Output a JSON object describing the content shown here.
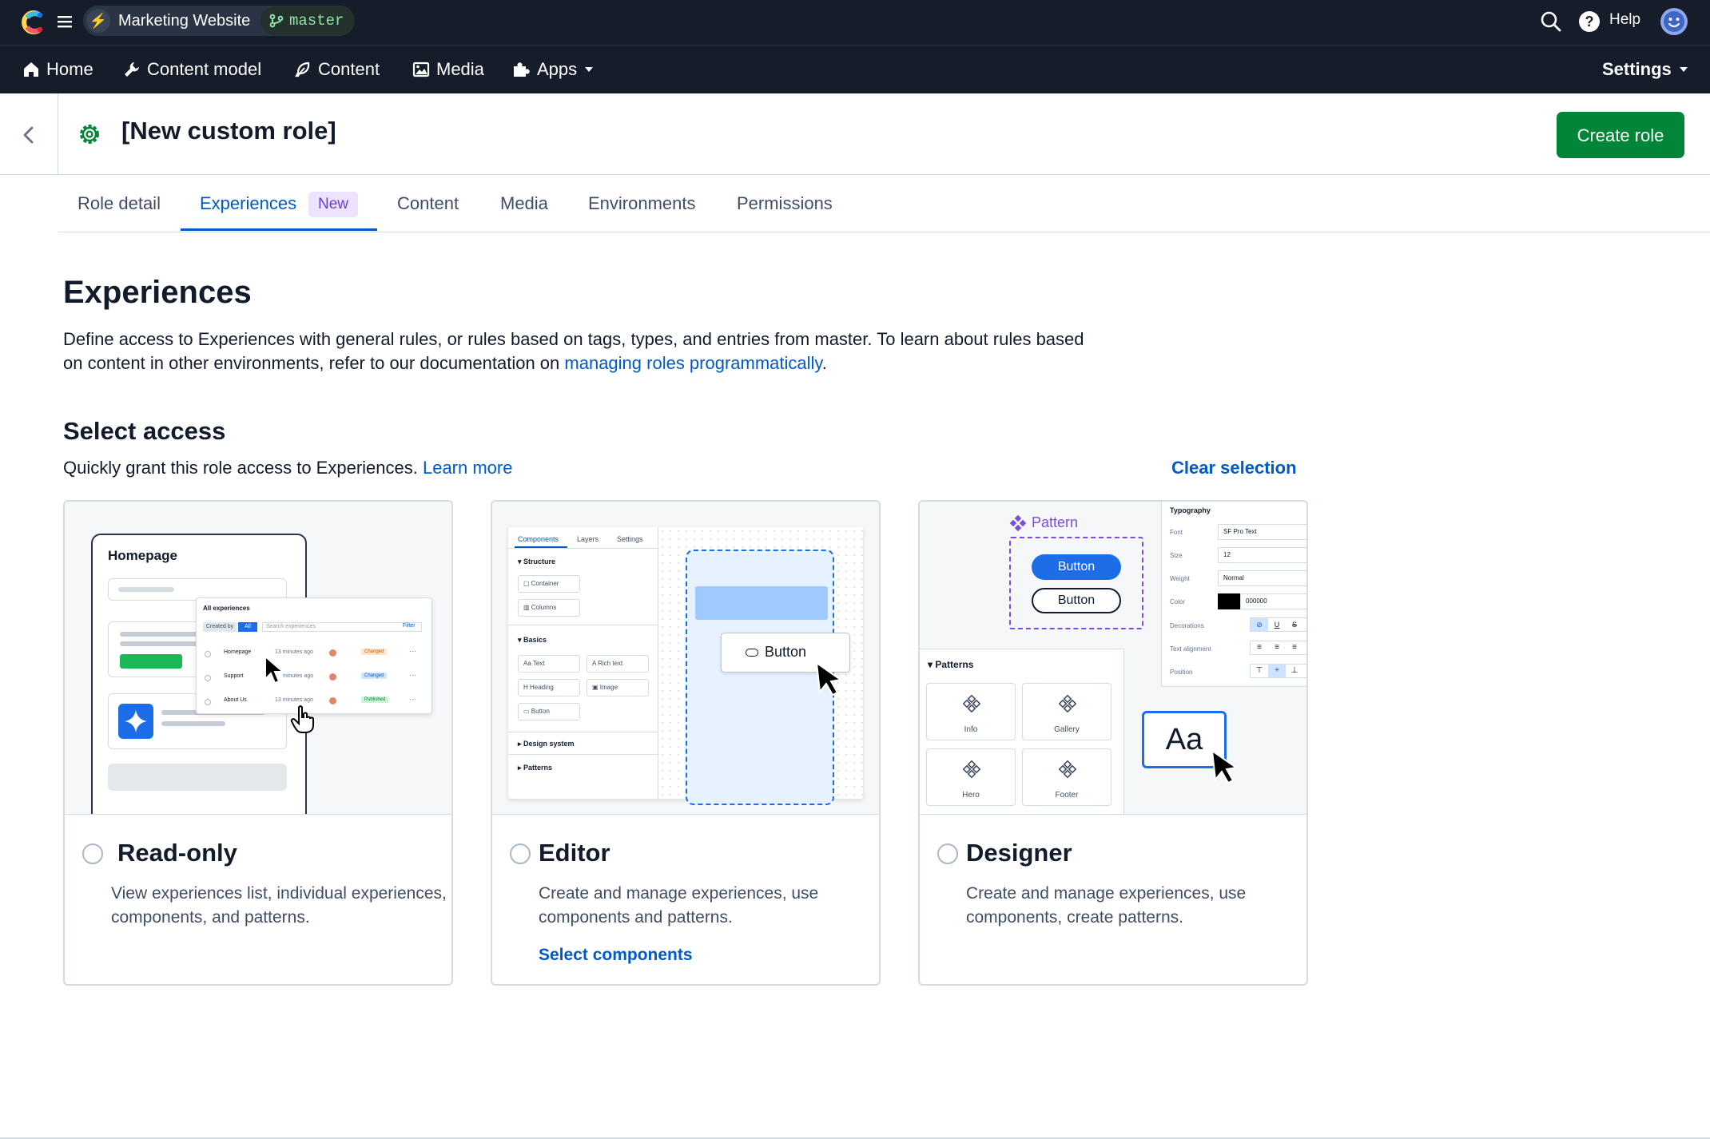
{
  "topbar": {
    "space_name": "Marketing Website",
    "environment": "master",
    "help": "Help",
    "icons": [
      "contentful-logo",
      "menu-icon",
      "bolt-icon",
      "branch-icon",
      "search-icon",
      "help-icon",
      "avatar"
    ]
  },
  "nav": {
    "items": [
      {
        "label": "Home",
        "icon": "home-icon"
      },
      {
        "label": "Content model",
        "icon": "wrench-icon"
      },
      {
        "label": "Content",
        "icon": "feather-icon"
      },
      {
        "label": "Media",
        "icon": "image-icon"
      },
      {
        "label": "Apps",
        "icon": "puzzle-icon"
      }
    ],
    "settings": "Settings"
  },
  "header": {
    "title": "[New custom role]",
    "create_label": "Create role"
  },
  "tabs": {
    "items": [
      "Role detail",
      "Experiences",
      "Content",
      "Media",
      "Environments",
      "Permissions"
    ],
    "active": "Experiences",
    "new_badge": "New"
  },
  "main": {
    "heading": "Experiences",
    "intro_text": "Define access to Experiences with general rules, or rules based on tags, types, and entries from master. To learn about rules based on content in other environments, refer to our documentation on ",
    "intro_link": "managing roles programmatically",
    "intro_end": ".",
    "select_heading": "Select access",
    "select_text": "Quickly grant this role access to Experiences. ",
    "learn_more": "Learn more",
    "clear_selection": "Clear selection"
  },
  "cards": [
    {
      "title": "Read-only",
      "desc": "View experiences list, individual experiences, components, and patterns.",
      "link": "",
      "selected": false
    },
    {
      "title": "Editor",
      "desc": "Create and manage experiences, use components and patterns.",
      "link": "Select components",
      "selected": false
    },
    {
      "title": "Designer",
      "desc": "Create and manage experiences, use components, create patterns.",
      "link": "",
      "selected": false
    }
  ],
  "illus_readonly": {
    "homepage": "Homepage",
    "list_title": "All experiences",
    "created_by": "Created by",
    "all": "All",
    "search": "Search experiences",
    "filter": "Filter",
    "rows": [
      {
        "name": "Homepage",
        "time": "13 minutes ago",
        "status": "Changed"
      },
      {
        "name": "Support",
        "time": "minutes ago",
        "status": "Changed"
      },
      {
        "name": "About Us",
        "time": "13 minutes ago",
        "status": "Published"
      }
    ]
  },
  "illus_editor": {
    "tabs": [
      "Components",
      "Layers",
      "Settings"
    ],
    "structure": "Structure",
    "container": "Container",
    "columns": "Columns",
    "basics": "Basics",
    "text": "Text",
    "rich_text": "Rich text",
    "heading": "Heading",
    "image": "Image",
    "button": "Button",
    "design_system": "Design system",
    "patterns": "Patterns",
    "canvas_button": "Button"
  },
  "illus_designer": {
    "pattern": "Pattern",
    "button1": "Button",
    "button2": "Button",
    "patterns": "Patterns",
    "tiles": [
      "Info",
      "Gallery",
      "Hero",
      "Footer"
    ],
    "typography": "Typography",
    "font_label": "Font",
    "font_value": "SF Pro Text",
    "size_label": "Size",
    "size_value": "12",
    "weight_label": "Weight",
    "weight_value": "Normal",
    "color_label": "Color",
    "color_value": "000000",
    "decorations": "Decorations",
    "text_alignment": "Text alignment",
    "position": "Position",
    "aa": "Aa"
  },
  "colors": {
    "topbar": "#151d2b",
    "primary": "#0059c8",
    "success": "#008539",
    "badge_bg": "#ede3ff",
    "badge_text": "#6c3ecf"
  }
}
